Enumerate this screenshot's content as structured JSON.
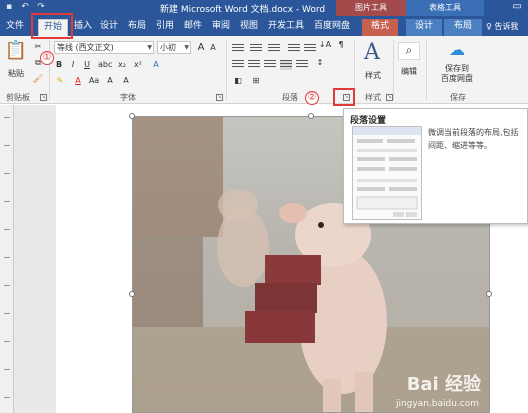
{
  "titlebar": {
    "document_title": "新建 Microsoft Word 文档.docx - Word",
    "picture_tools": "图片工具",
    "table_tools": "表格工具"
  },
  "tabs": [
    {
      "label": "文件"
    },
    {
      "label": "开始"
    },
    {
      "label": "插入"
    },
    {
      "label": "设计"
    },
    {
      "label": "布局"
    },
    {
      "label": "引用"
    },
    {
      "label": "邮件"
    },
    {
      "label": "审阅"
    },
    {
      "label": "视图"
    },
    {
      "label": "开发工具"
    },
    {
      "label": "百度网盘"
    },
    {
      "label": "格式"
    },
    {
      "label": "设计"
    },
    {
      "label": "布局"
    }
  ],
  "tell_me": "♀ 告诉我",
  "ribbon": {
    "paste_label": "粘贴",
    "font_name": "等线 (西文正文)",
    "font_size": "小初",
    "styles_label": "样式",
    "edit_label": "编辑",
    "save_baidu_label": "保存到\n百度网盘",
    "groups": {
      "clipboard": "剪贴板",
      "font": "字体",
      "paragraph": "段落",
      "styles": "样式",
      "save": "保存"
    }
  },
  "annotations": {
    "step1": "①",
    "step2": "②"
  },
  "tooltip": {
    "title": "段落设置",
    "description": "微调当前段落的布局,包括间距、缩进等等。"
  },
  "watermark": {
    "logo": "Bai 经验",
    "url": "jingyan.baidu.com"
  },
  "colors": {
    "word_blue": "#2b579a",
    "highlight_red": "#e23a3a"
  }
}
